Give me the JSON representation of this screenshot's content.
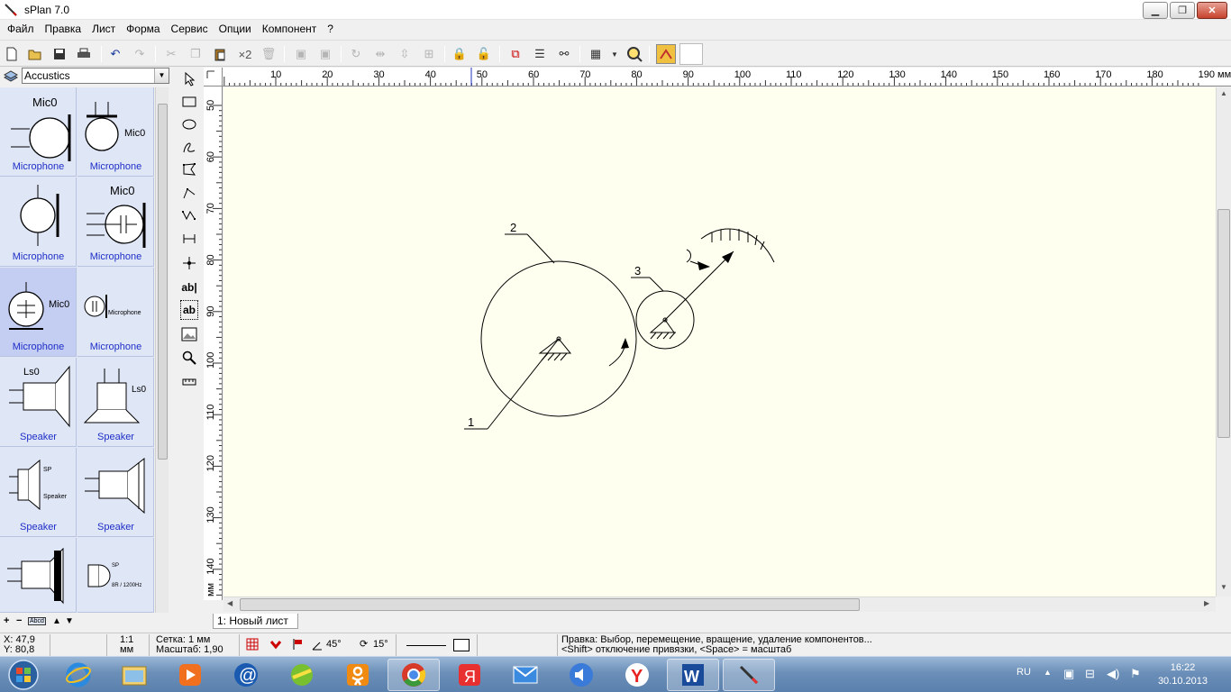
{
  "window": {
    "title": "sPlan 7.0",
    "minimize_label": "▁",
    "restore_label": "❐",
    "close_label": "✕"
  },
  "menu": [
    "Файл",
    "Правка",
    "Лист",
    "Форма",
    "Сервис",
    "Опции",
    "Компонент",
    "?"
  ],
  "toolbar": {
    "duplicate_label": "×2",
    "icons": [
      "new-icon",
      "open-icon",
      "save-icon",
      "print-icon",
      "undo-icon",
      "redo-icon",
      "cut-icon",
      "copy-icon",
      "paste-icon",
      "duplicate-icon",
      "delete-icon",
      "to-front-icon",
      "to-back-icon",
      "rotate-icon",
      "mirror-h-icon",
      "mirror-v-icon",
      "group-icon",
      "lock-icon",
      "unlock-icon",
      "snap-icon",
      "list-icon",
      "search-binoculars-icon",
      "grid-icon",
      "zoom-icon",
      "color-icon"
    ]
  },
  "library": {
    "selected": "Accustics",
    "items": [
      {
        "label": "Microphone",
        "symbol": "Mic0",
        "selected": false
      },
      {
        "label": "Microphone",
        "symbol": "Mic0",
        "selected": false
      },
      {
        "label": "Microphone",
        "symbol": "",
        "selected": false
      },
      {
        "label": "Microphone",
        "symbol": "Mic0",
        "selected": false
      },
      {
        "label": "Microphone",
        "symbol": "Mic0",
        "selected": true
      },
      {
        "label": "Microphone",
        "symbol": "Microphone",
        "selected": false
      },
      {
        "label": "Speaker",
        "symbol": "Ls0",
        "selected": false
      },
      {
        "label": "Speaker",
        "symbol": "Ls0",
        "selected": false
      },
      {
        "label": "Speaker",
        "symbol": "SP Speaker",
        "selected": false
      },
      {
        "label": "Speaker",
        "symbol": "",
        "selected": false
      },
      {
        "label": "",
        "symbol": "",
        "selected": false
      },
      {
        "label": "",
        "symbol": "SP 8R / 1200Hz",
        "selected": false
      }
    ],
    "bottom_controls": [
      "+",
      "−",
      "Abcd",
      "▲",
      "▼"
    ]
  },
  "tools": [
    "select-arrow-icon",
    "rectangle-icon",
    "ellipse-icon",
    "bezier-icon",
    "polygon-icon",
    "polyline-icon",
    "curve-icon",
    "dimension-icon",
    "node-icon",
    "text-icon",
    "textframe-icon",
    "image-icon",
    "magnify-icon",
    "measure-icon"
  ],
  "tool_text_label": "ab|",
  "tool_textframe_label": "ab",
  "ruler": {
    "h_labels": [
      "10",
      "20",
      "30",
      "40",
      "50",
      "60",
      "70",
      "80",
      "90",
      "100",
      "110",
      "120",
      "130",
      "140",
      "150",
      "160",
      "170",
      "180",
      "190 мм"
    ],
    "v_labels": [
      "50",
      "60",
      "70",
      "80",
      "90",
      "100",
      "110",
      "120",
      "130",
      "140",
      "мм"
    ]
  },
  "drawing": {
    "labels": [
      "1",
      "2",
      "3"
    ]
  },
  "sheet_tab": "1: Новый лист",
  "status": {
    "x": "X: 47,9",
    "y": "Y: 80,8",
    "scale_ratio": "1:1",
    "scale_unit": "мм",
    "grid": "Сетка: 1 мм",
    "zoom": "Масштаб:  1,90",
    "angle1": "45°",
    "angle2": "15°",
    "hint1": "Правка: Выбор, перемещение, вращение, удаление компонентов...",
    "hint2": "<Shift> отключение привязки, <Space> = масштаб"
  },
  "taskbar": {
    "lang": "RU",
    "time": "16:22",
    "date": "30.10.2013",
    "apps": [
      "start-orb-icon",
      "internet-explorer-icon",
      "file-explorer-icon",
      "media-player-icon",
      "mail-at-icon",
      "game-icon",
      "odnoklassniki-icon",
      "chrome-icon",
      "yandex-icon",
      "mail-envelope-icon",
      "speaker-icon",
      "yandex-browser-icon",
      "word-icon",
      "splan-icon"
    ]
  },
  "colors": {
    "canvas": "#fffff0",
    "library_bg": "#dfe6f6",
    "library_selected": "#c4cdf2",
    "library_label": "#1e2ec8"
  }
}
